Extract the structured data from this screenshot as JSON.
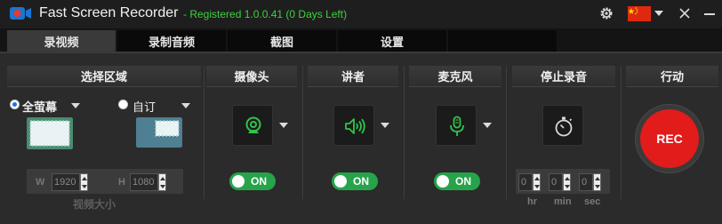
{
  "app": {
    "title": "Fast Screen Recorder",
    "registration": "- Registered 1.0.0.41 (0 Days Left)"
  },
  "tabs": [
    {
      "label": "录视频",
      "active": true
    },
    {
      "label": "录制音频",
      "active": false
    },
    {
      "label": "截图",
      "active": false
    },
    {
      "label": "设置",
      "active": false
    }
  ],
  "sections": {
    "area": "选择区域",
    "camera": "摄像头",
    "narrator": "讲者",
    "microphone": "麦克风",
    "stop": "停止录音",
    "action": "行动"
  },
  "area": {
    "fullscreen_label": "全萤幕",
    "custom_label": "自订",
    "selected": "fullscreen"
  },
  "video_size": {
    "title": "视频大小",
    "width_label": "W",
    "width_value": "1920",
    "height_label": "H",
    "height_value": "1080"
  },
  "toggles": {
    "camera": "ON",
    "narrator": "ON",
    "microphone": "ON"
  },
  "stop_timer": {
    "hr": "0",
    "min": "0",
    "sec": "0",
    "hr_label": "hr",
    "min_label": "min",
    "sec_label": "sec"
  },
  "rec_label": "REC",
  "icons": {
    "app": "camera-record-icon",
    "settings": "gear-icon",
    "language": "china-flag-icon",
    "close": "close-icon",
    "minimize": "minimize-icon",
    "webcam": "webcam-icon",
    "speaker": "speaker-icon",
    "microphone": "microphone-icon",
    "stopwatch": "stopwatch-icon"
  },
  "colors": {
    "accent_green": "#27a34a",
    "icon_green": "#2fc44a",
    "rec_red": "#e21b1b",
    "registered_green": "#3dd13d"
  }
}
